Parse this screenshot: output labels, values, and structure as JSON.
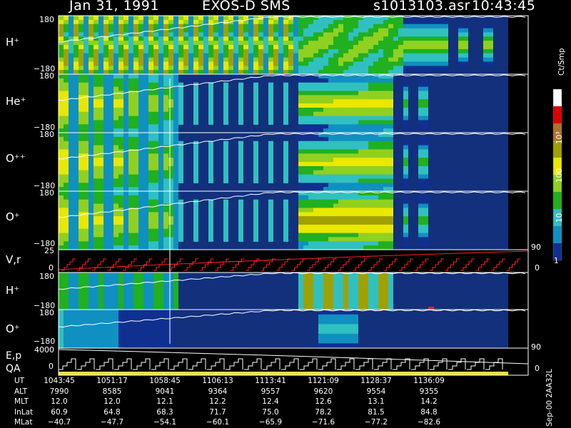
{
  "header": {
    "date": "Jan 31, 1991",
    "instrument": "EXOS-D SMS",
    "filename": "s1013103.asr",
    "time": "10:43:45"
  },
  "colorbar": {
    "unit": "Ct/Smp",
    "ticks": [
      "10⁴",
      "10³",
      "100",
      "10",
      "1"
    ],
    "colors": [
      "#ffffff",
      "#dd0000",
      "#b07030",
      "#a0a000",
      "#e8e800",
      "#90d020",
      "#20b020",
      "#30c0c0",
      "#1090c0",
      "#103090"
    ]
  },
  "chart_data": {
    "type": "heatmap",
    "panels": [
      {
        "name": "h-plus-spectrogram",
        "label": "H⁺",
        "ytop": "180",
        "ybot": "−180"
      },
      {
        "name": "he-plus-spectrogram",
        "label": "He⁺",
        "ytop": "180",
        "ybot": "−180"
      },
      {
        "name": "o-plusplus-spectrogram",
        "label": "O⁺⁺",
        "ytop": "180",
        "ybot": "−180"
      },
      {
        "name": "o-plus-spectrogram",
        "label": "O⁺",
        "ytop": "180",
        "ybot": "−180"
      },
      {
        "name": "vr-panel",
        "label": "V,r",
        "ytop": "25",
        "ybot": "0",
        "right_top": "90",
        "right_bot": "0"
      },
      {
        "name": "h-plus-2-spectrogram",
        "label": "H⁺",
        "ytop": "180",
        "ybot": "−180"
      },
      {
        "name": "o-plus-2-spectrogram",
        "label": "O⁺",
        "ytop": "180",
        "ybot": "−180"
      },
      {
        "name": "ep-qa-panel",
        "label": "E,p",
        "label2": "QA",
        "ytop": "4000",
        "ybot": "0",
        "right_top": "90",
        "right_bot": "0"
      }
    ],
    "ticks": {
      "rows": [
        "UT",
        "ALT",
        "MLT",
        "InLat",
        "MLat"
      ],
      "UT": [
        "1043:45",
        "1051:17",
        "1058:45",
        "1106:13",
        "1113:41",
        "1121:09",
        "1128:37",
        "1136:09"
      ],
      "ALT": [
        "7990",
        "8585",
        "9041",
        "9364",
        "9557",
        "9620",
        "9554",
        "9355"
      ],
      "MLT": [
        "12.0",
        "12.0",
        "12.1",
        "12.2",
        "12.4",
        "12.6",
        "13.1",
        "14.2"
      ],
      "InLat": [
        "60.9",
        "64.8",
        "68.3",
        "71.7",
        "75.0",
        "78.2",
        "81.5",
        "84.8"
      ],
      "MLat": [
        "−40.7",
        "−47.7",
        "−54.1",
        "−60.1",
        "−65.9",
        "−71.6",
        "−77.2",
        "−82.6"
      ]
    }
  },
  "footer": {
    "note": "Sep-00 2AA32L"
  }
}
